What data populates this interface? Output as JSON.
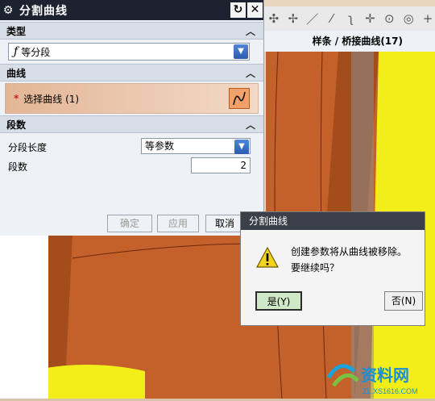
{
  "dialog": {
    "title": "分割曲线",
    "sections": {
      "type_label": "类型",
      "curve_label": "曲线",
      "segments_label": "段数"
    },
    "type_value": "等分段",
    "select_curve_label": "选择曲线 (1)",
    "segment_length_label": "分段长度",
    "segment_length_value": "等参数",
    "segment_count_label": "段数",
    "segment_count_value": "2",
    "buttons": {
      "ok": "确定",
      "apply": "应用",
      "cancel": "取消"
    }
  },
  "viewport": {
    "status_text": "样条 / 桥接曲线(17)"
  },
  "confirm": {
    "title": "分割曲线",
    "message_line1": "创建参数将从曲线被移除。",
    "message_line2": "要继续吗？",
    "yes": "是(Y)",
    "no": "否(N)"
  },
  "watermark": {
    "brand": "资料网",
    "url": "ZL.XS1616.COM"
  }
}
